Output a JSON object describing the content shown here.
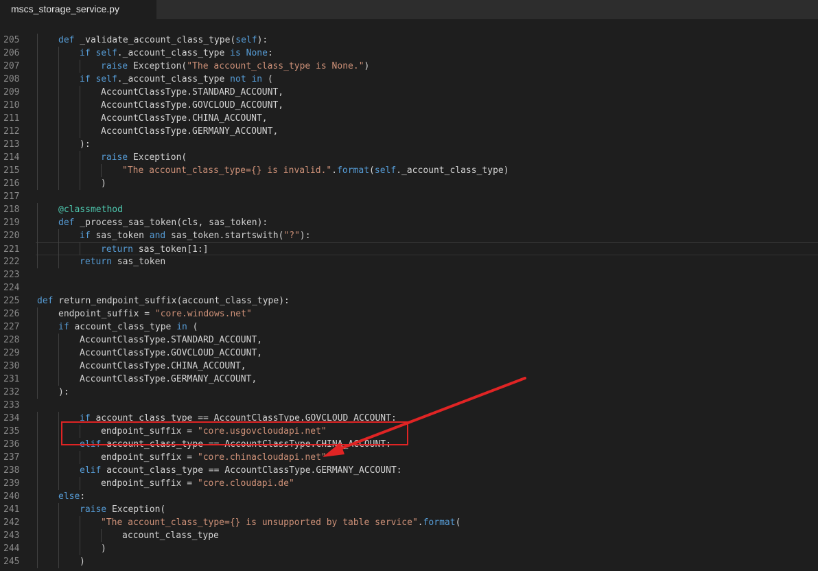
{
  "tab": {
    "title": "mscs_storage_service.py"
  },
  "colors": {
    "keyword": "#569cd6",
    "string": "#ce9178",
    "plain": "#d4d4d4",
    "builtin": "#4ec9b0"
  },
  "current_line": 221,
  "code_lines": [
    {
      "n": "205",
      "indent": 1,
      "tokens": [
        [
          "def",
          "keyword"
        ],
        [
          " _validate_account_class_type(",
          "plain"
        ],
        [
          "self",
          "keyword"
        ],
        [
          "):",
          "plain"
        ]
      ]
    },
    {
      "n": "206",
      "indent": 2,
      "tokens": [
        [
          "if",
          "keyword"
        ],
        [
          " ",
          "plain"
        ],
        [
          "self",
          "keyword"
        ],
        [
          "._account_class_type ",
          "plain"
        ],
        [
          "is",
          "keyword"
        ],
        [
          " ",
          "plain"
        ],
        [
          "None",
          "keyword"
        ],
        [
          ":",
          "plain"
        ]
      ]
    },
    {
      "n": "207",
      "indent": 3,
      "tokens": [
        [
          "raise",
          "keyword"
        ],
        [
          " Exception(",
          "plain"
        ],
        [
          "\"The account_class_type is None.\"",
          "string"
        ],
        [
          ")",
          "plain"
        ]
      ]
    },
    {
      "n": "208",
      "indent": 2,
      "tokens": [
        [
          "if",
          "keyword"
        ],
        [
          " ",
          "plain"
        ],
        [
          "self",
          "keyword"
        ],
        [
          "._account_class_type ",
          "plain"
        ],
        [
          "not",
          "keyword"
        ],
        [
          " ",
          "plain"
        ],
        [
          "in",
          "keyword"
        ],
        [
          " (",
          "plain"
        ]
      ]
    },
    {
      "n": "209",
      "indent": 3,
      "tokens": [
        [
          "AccountClassType.STANDARD_ACCOUNT,",
          "plain"
        ]
      ]
    },
    {
      "n": "210",
      "indent": 3,
      "tokens": [
        [
          "AccountClassType.GOVCLOUD_ACCOUNT,",
          "plain"
        ]
      ]
    },
    {
      "n": "211",
      "indent": 3,
      "tokens": [
        [
          "AccountClassType.CHINA_ACCOUNT,",
          "plain"
        ]
      ]
    },
    {
      "n": "212",
      "indent": 3,
      "tokens": [
        [
          "AccountClassType.GERMANY_ACCOUNT,",
          "plain"
        ]
      ]
    },
    {
      "n": "213",
      "indent": 2,
      "tokens": [
        [
          "):",
          "plain"
        ]
      ]
    },
    {
      "n": "214",
      "indent": 3,
      "tokens": [
        [
          "raise",
          "keyword"
        ],
        [
          " Exception(",
          "plain"
        ]
      ]
    },
    {
      "n": "215",
      "indent": 4,
      "tokens": [
        [
          "\"The account_class_type={} is invalid.\"",
          "string"
        ],
        [
          ".",
          "plain"
        ],
        [
          "format",
          "keyword"
        ],
        [
          "(",
          "plain"
        ],
        [
          "self",
          "keyword"
        ],
        [
          "._account_class_type)",
          "plain"
        ]
      ]
    },
    {
      "n": "216",
      "indent": 3,
      "tokens": [
        [
          ")",
          "plain"
        ]
      ]
    },
    {
      "n": "217",
      "indent": 0,
      "tokens": []
    },
    {
      "n": "218",
      "indent": 1,
      "tokens": [
        [
          "@classmethod",
          "builtin"
        ]
      ]
    },
    {
      "n": "219",
      "indent": 1,
      "tokens": [
        [
          "def",
          "keyword"
        ],
        [
          " _process_sas_token(cls, sas_token):",
          "plain"
        ]
      ]
    },
    {
      "n": "220",
      "indent": 2,
      "tokens": [
        [
          "if",
          "keyword"
        ],
        [
          " sas_token ",
          "plain"
        ],
        [
          "and",
          "keyword"
        ],
        [
          " sas_token.startswith(",
          "plain"
        ],
        [
          "\"?\"",
          "string"
        ],
        [
          "):",
          "plain"
        ]
      ]
    },
    {
      "n": "221",
      "indent": 3,
      "tokens": [
        [
          "return",
          "keyword"
        ],
        [
          " sas_token[1:]",
          "plain"
        ]
      ]
    },
    {
      "n": "222",
      "indent": 2,
      "tokens": [
        [
          "return",
          "keyword"
        ],
        [
          " sas_token",
          "plain"
        ]
      ]
    },
    {
      "n": "223",
      "indent": 0,
      "tokens": []
    },
    {
      "n": "224",
      "indent": 0,
      "tokens": []
    },
    {
      "n": "225",
      "indent": 0,
      "tokens": [
        [
          "def",
          "keyword"
        ],
        [
          " return_endpoint_suffix(account_class_type):",
          "plain"
        ]
      ]
    },
    {
      "n": "226",
      "indent": 1,
      "tokens": [
        [
          "endpoint_suffix = ",
          "plain"
        ],
        [
          "\"core.windows.net\"",
          "string"
        ]
      ]
    },
    {
      "n": "227",
      "indent": 1,
      "tokens": [
        [
          "if",
          "keyword"
        ],
        [
          " account_class_type ",
          "plain"
        ],
        [
          "in",
          "keyword"
        ],
        [
          " (",
          "plain"
        ]
      ]
    },
    {
      "n": "228",
      "indent": 2,
      "tokens": [
        [
          "AccountClassType.STANDARD_ACCOUNT,",
          "plain"
        ]
      ]
    },
    {
      "n": "229",
      "indent": 2,
      "tokens": [
        [
          "AccountClassType.GOVCLOUD_ACCOUNT,",
          "plain"
        ]
      ]
    },
    {
      "n": "230",
      "indent": 2,
      "tokens": [
        [
          "AccountClassType.CHINA_ACCOUNT,",
          "plain"
        ]
      ]
    },
    {
      "n": "231",
      "indent": 2,
      "tokens": [
        [
          "AccountClassType.GERMANY_ACCOUNT,",
          "plain"
        ]
      ]
    },
    {
      "n": "232",
      "indent": 1,
      "tokens": [
        [
          "):",
          "plain"
        ]
      ]
    },
    {
      "n": "233",
      "indent": 0,
      "tokens": []
    },
    {
      "n": "234",
      "indent": 2,
      "tokens": [
        [
          "if",
          "keyword"
        ],
        [
          " account_class_type == AccountClassType.GOVCLOUD_ACCOUNT:",
          "plain"
        ]
      ]
    },
    {
      "n": "235",
      "indent": 3,
      "tokens": [
        [
          "endpoint_suffix = ",
          "plain"
        ],
        [
          "\"core.usgovcloudapi.net\"",
          "string"
        ]
      ]
    },
    {
      "n": "236",
      "indent": 2,
      "tokens": [
        [
          "elif",
          "keyword"
        ],
        [
          " account_class_type == AccountClassType.CHINA_ACCOUNT:",
          "plain"
        ]
      ]
    },
    {
      "n": "237",
      "indent": 3,
      "tokens": [
        [
          "endpoint_suffix = ",
          "plain"
        ],
        [
          "\"core.chinacloudapi.net\"",
          "string"
        ]
      ]
    },
    {
      "n": "238",
      "indent": 2,
      "tokens": [
        [
          "elif",
          "keyword"
        ],
        [
          " account_class_type == AccountClassType.GERMANY_ACCOUNT:",
          "plain"
        ]
      ]
    },
    {
      "n": "239",
      "indent": 3,
      "tokens": [
        [
          "endpoint_suffix = ",
          "plain"
        ],
        [
          "\"core.cloudapi.de\"",
          "string"
        ]
      ]
    },
    {
      "n": "240",
      "indent": 1,
      "tokens": [
        [
          "else",
          "keyword"
        ],
        [
          ":",
          "plain"
        ]
      ]
    },
    {
      "n": "241",
      "indent": 2,
      "tokens": [
        [
          "raise",
          "keyword"
        ],
        [
          " Exception(",
          "plain"
        ]
      ]
    },
    {
      "n": "242",
      "indent": 3,
      "tokens": [
        [
          "\"The account_class_type={} is unsupported by table service\"",
          "string"
        ],
        [
          ".",
          "plain"
        ],
        [
          "format",
          "keyword"
        ],
        [
          "(",
          "plain"
        ]
      ]
    },
    {
      "n": "243",
      "indent": 4,
      "tokens": [
        [
          "account_class_type",
          "plain"
        ]
      ]
    },
    {
      "n": "244",
      "indent": 3,
      "tokens": [
        [
          ")",
          "plain"
        ]
      ]
    },
    {
      "n": "245",
      "indent": 2,
      "tokens": [
        [
          ")",
          "plain"
        ]
      ]
    }
  ],
  "annotation": {
    "highlighted_lines": [
      "236",
      "237"
    ],
    "arrow_color": "#e02424",
    "box_color": "#e02424"
  }
}
